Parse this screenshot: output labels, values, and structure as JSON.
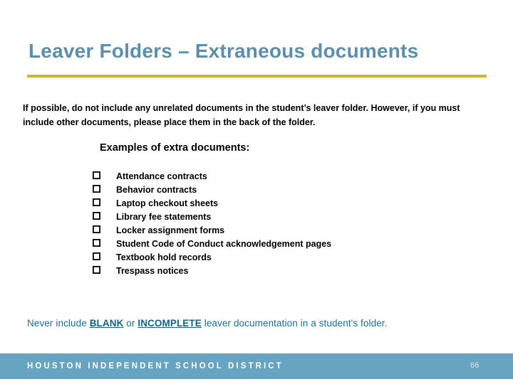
{
  "slide": {
    "title": "Leaver Folders – Extraneous documents",
    "intro": "If possible, do not include any unrelated documents in the student’s leaver folder. However, if you must include other documents, please place them in the back of the folder.",
    "sub_heading": "Examples of extra documents:",
    "list_bullet_icon": "empty-checkbox-icon",
    "documents": [
      "Attendance contracts",
      "Behavior contracts",
      "Laptop checkout sheets",
      "Library fee statements",
      "Locker assignment forms",
      "Student Code of Conduct acknowledgement pages",
      "Textbook hold records",
      "Trespass notices"
    ],
    "note": {
      "lead": "Never include ",
      "emph_1": "BLANK",
      "mid": " or ",
      "emph_2": "INCOMPLETE",
      "tail": " leaver documentation in a student's folder."
    }
  },
  "footer": {
    "brand": "HOUSTON INDEPENDENT SCHOOL DISTRICT",
    "page_number": "66"
  },
  "colors": {
    "title": "#5B8FAD",
    "gold_rule": "#D3B22F",
    "footer_bar": "#66A4C1",
    "note_text": "#1A6E99",
    "body_text": "#000000"
  }
}
